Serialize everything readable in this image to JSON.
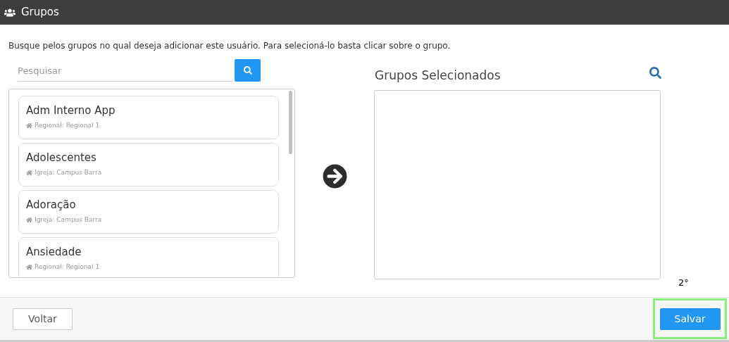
{
  "header": {
    "title": "Grupos"
  },
  "instructions": "Busque pelos grupos no qual deseja adicionar este usuário. Para selecioná-lo basta clicar sobre o grupo.",
  "search": {
    "placeholder": "Pesquisar"
  },
  "groups": [
    {
      "name": "Adm Interno App",
      "detail": "Regional: Regional 1"
    },
    {
      "name": "Adolescentes",
      "detail": "Igreja: Campus Barra"
    },
    {
      "name": "Adoração",
      "detail": "Igreja: Campus Barra"
    },
    {
      "name": "Ansiedade",
      "detail": "Regional: Regional 1"
    }
  ],
  "selected_panel": {
    "title": "Grupos Selecionados"
  },
  "footer": {
    "back": "Voltar",
    "save": "Salvar",
    "annotation": "2°"
  }
}
